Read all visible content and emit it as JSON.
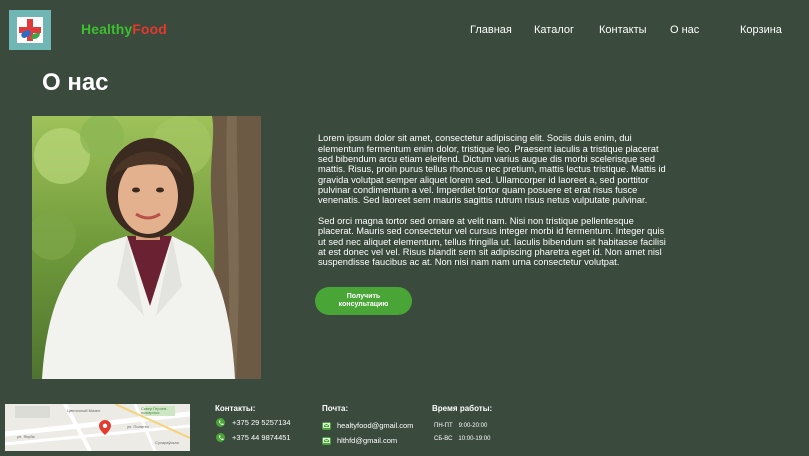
{
  "header": {
    "brand_part1": "Healthy",
    "brand_part2": "Food",
    "nav": [
      "Главная",
      "Каталог",
      "Контакты",
      "О нас",
      "Корзина"
    ]
  },
  "main": {
    "title": "О нас",
    "paragraph1": "Lorem ipsum dolor sit amet, consectetur adipiscing elit. Sociis duis enim, dui elementum fermentum enim dolor, tristique leo. Praesent iaculis a tristique placerat sed bibendum arcu etiam eleifend. Dictum varius augue dis morbi scelerisque sed mattis. Risus, proin purus tellus rhoncus nec pretium, mattis lectus tristique. Mattis id gravida volutpat semper aliquet lorem sed. Ullamcorper id laoreet a, sed porttitor pulvinar condimentum a vel. Imperdiet tortor quam posuere et erat risus fusce venenatis. Sed laoreet sem mauris sagittis rutrum risus netus vulputate pulvinar.",
    "paragraph2": "Sed orci magna tortor sed ornare at velit nam. Nisi non tristique pellentesque placerat. Mauris sed consectetur vel cursus integer morbi id fermentum. Integer quis ut sed nec aliquet elementum, tellus fringilla ut. Iaculis bibendum sit habitasse facilisi at est donec vel vel. Risus blandit sem sit adipiscing pharetra eget id. Non amet nisl suspendisse faucibus ac at. Non nisi nam nam urna consectetur volutpat.",
    "cta_label": "Получить консультацию"
  },
  "footer": {
    "map_labels": [
      "Цветочный Мазел",
      "Сквер Героев-пожарных",
      "ул. Политех",
      "ул. Якуба",
      "Сухараўская"
    ],
    "contacts_heading": "Контакты:",
    "phones": [
      "+375 29 5257134",
      "+375 44 9874451"
    ],
    "mail_heading": "Почта:",
    "emails": [
      "healtyfood@gmail.com",
      "hlthfd@gmail.com"
    ],
    "hours_heading": "Время работы:",
    "hours": [
      {
        "days": "ПН-ПТ",
        "time": "9:00-20:00"
      },
      {
        "days": "СБ-ВС",
        "time": "10:00-19:00"
      }
    ]
  },
  "colors": {
    "background": "#3a4a3d",
    "accent_green": "#49a536",
    "brand_green": "#3cbe2f",
    "brand_red": "#e5382c"
  }
}
